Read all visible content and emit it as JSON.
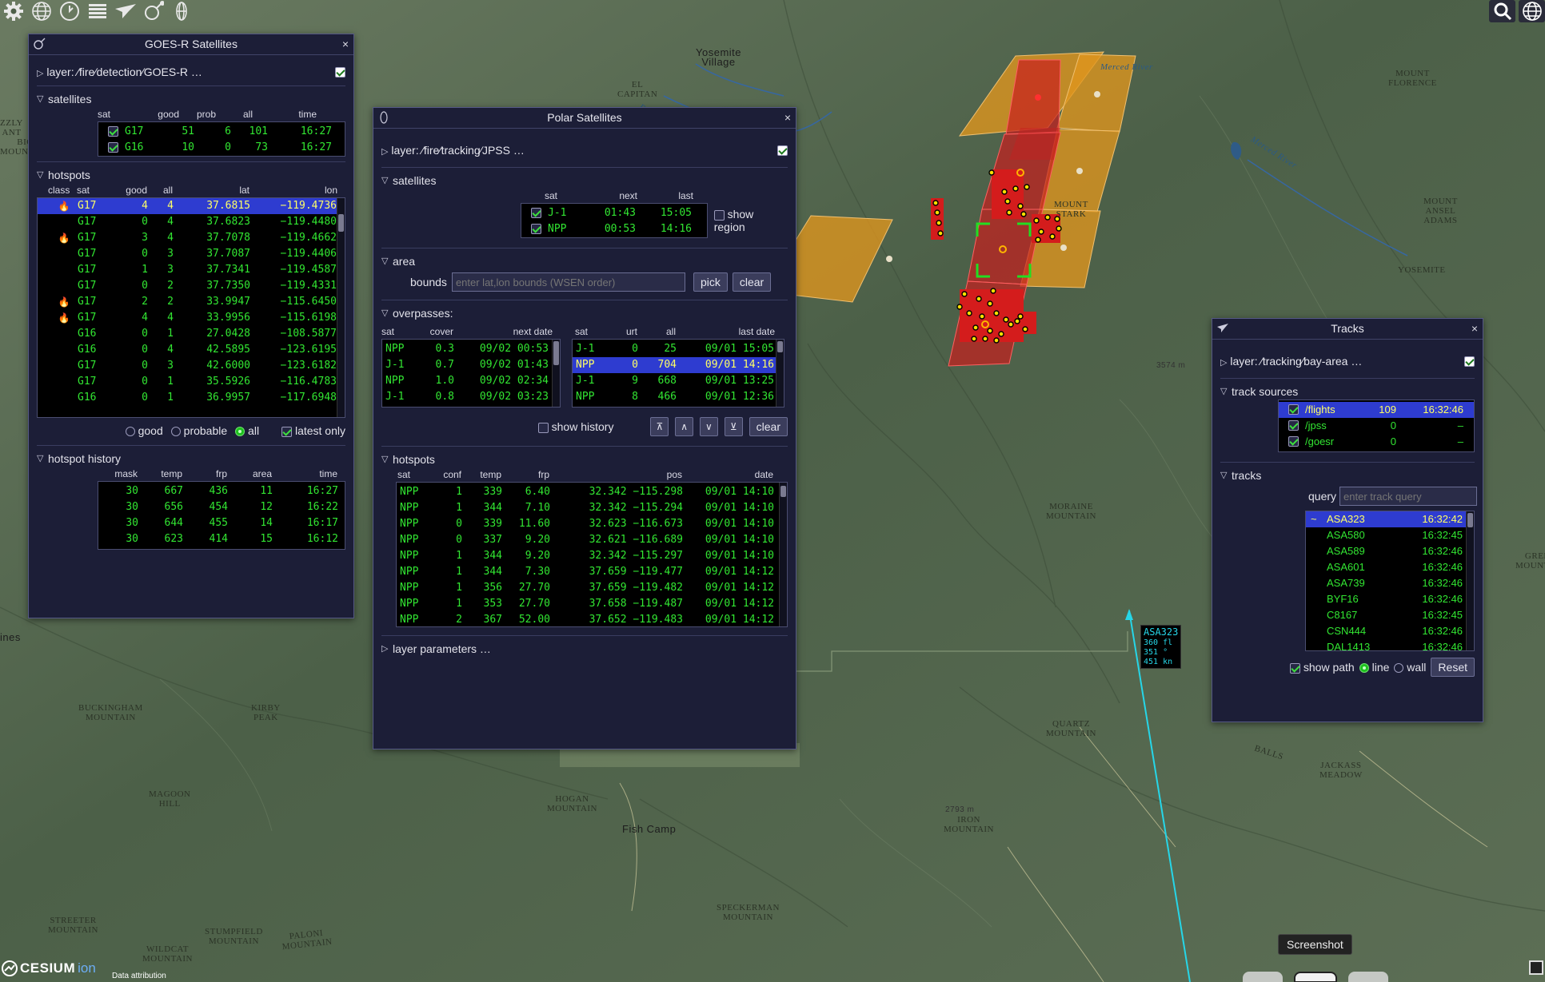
{
  "colors": {
    "window_bg": "#1c1e37",
    "list_fg": "#32e632",
    "selected_bg": "#2e3cd0",
    "selected_fg": "#ffff66",
    "fire_red": "#c81e1e",
    "fire_orange": "#e0961e",
    "track_line": "#26d6e8"
  },
  "toolbar": {
    "icons": [
      "gear-icon",
      "globe-icon",
      "clock-icon",
      "layers-icon",
      "plane-icon",
      "satellite-icon",
      "polar-satellite-icon"
    ],
    "right_icons": [
      "search-icon",
      "globe-icon"
    ]
  },
  "map_labels": [
    {
      "t": "Yosemite\nVillage",
      "cls": "town"
    },
    {
      "t": "EL\nCAPITAN",
      "cls": ""
    },
    {
      "t": "Merced River",
      "cls": "river"
    },
    {
      "t": "River",
      "cls": "river"
    },
    {
      "t": "Merced River",
      "cls": "river"
    },
    {
      "t": "MOUNT\nFLORENCE",
      "cls": ""
    },
    {
      "t": "MOUNT\nANSEL\nADAMS",
      "cls": ""
    },
    {
      "t": "YOSEMITE",
      "cls": ""
    },
    {
      "t": "GREEN\nMOUNTAIN",
      "cls": ""
    },
    {
      "t": "MOUNT\nSTARK",
      "cls": ""
    },
    {
      "t": "MORAINE\nMOUNTAIN",
      "cls": ""
    },
    {
      "t": "QUARTZ\nMOUNTAIN",
      "cls": ""
    },
    {
      "t": "BUCKINGHAM\nMOUNTAIN",
      "cls": ""
    },
    {
      "t": "KIRBY\nPEAK",
      "cls": ""
    },
    {
      "t": "MAGOON\nHILL",
      "cls": ""
    },
    {
      "t": "HOGAN\nMOUNTAIN",
      "cls": ""
    },
    {
      "t": "Fish Camp",
      "cls": "town"
    },
    {
      "t": "2793 m",
      "cls": "elev"
    },
    {
      "t": "IRON\nMOUNTAIN",
      "cls": ""
    },
    {
      "t": "3574 m",
      "cls": "elev"
    },
    {
      "t": "STREETER\nMOUNTAIN",
      "cls": ""
    },
    {
      "t": "STUMPFIELD\nMOUNTAIN",
      "cls": ""
    },
    {
      "t": "PALONI\nMOUNTAIN",
      "cls": ""
    },
    {
      "t": "WILDCAT\nMOUNTAIN",
      "cls": ""
    },
    {
      "t": "SPECKERMAN\nMOUNTAIN",
      "cls": ""
    },
    {
      "t": "JACKASS\nMEADOW",
      "cls": ""
    },
    {
      "t": "BALLS",
      "cls": ""
    },
    {
      "t": "ines",
      "cls": "town"
    },
    {
      "t": "ZZLY\nANT",
      "cls": ""
    },
    {
      "t": "BIG\nMOUNTAIN",
      "cls": ""
    }
  ],
  "goes": {
    "title": "GOES-R Satellites",
    "layer": "layer: ∕fire∕detection∕GOES-R …",
    "satellites_label": "satellites",
    "sat_headers": [
      "sat",
      "good",
      "prob",
      "all",
      "time"
    ],
    "satellites": [
      {
        "sat": "G17",
        "good": "51",
        "prob": "6",
        "all": "101",
        "time": "16:27"
      },
      {
        "sat": "G16",
        "good": "10",
        "prob": "0",
        "all": "73",
        "time": "16:27"
      }
    ],
    "hotspots_label": "hotspots",
    "hs_headers": [
      "class",
      "sat",
      "good",
      "all",
      "lat",
      "lon"
    ],
    "hotspots": [
      {
        "fire": true,
        "sat": "G17",
        "good": "4",
        "all": "4",
        "lat": "37.6815",
        "lon": "−119.4736"
      },
      {
        "fire": false,
        "sat": "G17",
        "good": "0",
        "all": "4",
        "lat": "37.6823",
        "lon": "−119.4480"
      },
      {
        "fire": true,
        "sat": "G17",
        "good": "3",
        "all": "4",
        "lat": "37.7078",
        "lon": "−119.4662"
      },
      {
        "fire": false,
        "sat": "G17",
        "good": "0",
        "all": "3",
        "lat": "37.7087",
        "lon": "−119.4406"
      },
      {
        "fire": false,
        "sat": "G17",
        "good": "1",
        "all": "3",
        "lat": "37.7341",
        "lon": "−119.4587"
      },
      {
        "fire": false,
        "sat": "G17",
        "good": "0",
        "all": "2",
        "lat": "37.7350",
        "lon": "−119.4331"
      },
      {
        "fire": true,
        "sat": "G17",
        "good": "2",
        "all": "2",
        "lat": "33.9947",
        "lon": "−115.6450"
      },
      {
        "fire": true,
        "sat": "G17",
        "good": "4",
        "all": "4",
        "lat": "33.9956",
        "lon": "−115.6198"
      },
      {
        "fire": false,
        "sat": "G16",
        "good": "0",
        "all": "1",
        "lat": "27.0428",
        "lon": "−108.5877"
      },
      {
        "fire": false,
        "sat": "G16",
        "good": "0",
        "all": "4",
        "lat": "42.5895",
        "lon": "−123.6195"
      },
      {
        "fire": false,
        "sat": "G17",
        "good": "0",
        "all": "3",
        "lat": "42.6000",
        "lon": "−123.6182"
      },
      {
        "fire": false,
        "sat": "G17",
        "good": "0",
        "all": "1",
        "lat": "35.5926",
        "lon": "−116.4783"
      },
      {
        "fire": false,
        "sat": "G16",
        "good": "0",
        "all": "1",
        "lat": "36.9957",
        "lon": "−117.6948"
      }
    ],
    "filters": {
      "good": "good",
      "probable": "probable",
      "all": "all",
      "latest_only": "latest only"
    },
    "history_label": "hotspot history",
    "hist_headers": [
      "mask",
      "temp",
      "frp",
      "area",
      "time"
    ],
    "history": [
      {
        "mask": "30",
        "temp": "667",
        "frp": "436",
        "area": "11",
        "time": "16:27"
      },
      {
        "mask": "30",
        "temp": "656",
        "frp": "454",
        "area": "12",
        "time": "16:22"
      },
      {
        "mask": "30",
        "temp": "644",
        "frp": "455",
        "area": "14",
        "time": "16:17"
      },
      {
        "mask": "30",
        "temp": "623",
        "frp": "414",
        "area": "15",
        "time": "16:12"
      }
    ]
  },
  "polar": {
    "title": "Polar Satellites",
    "layer": "layer: ∕fire∕tracking∕JPSS …",
    "satellites_label": "satellites",
    "sat_headers": [
      "sat",
      "next",
      "last"
    ],
    "satellites": [
      {
        "sat": "J-1",
        "next": "01:43",
        "last": "15:05"
      },
      {
        "sat": "NPP",
        "next": "00:53",
        "last": "14:16"
      }
    ],
    "show_region": "show region",
    "area_label": "area",
    "bounds_label": "bounds",
    "bounds_placeholder": "enter lat,lon bounds (WSEN order)",
    "pick": "pick",
    "clear": "clear",
    "overpasses_label": "overpasses:",
    "op_left_headers": [
      "sat",
      "cover",
      "next date"
    ],
    "op_left": [
      {
        "sat": "NPP",
        "cover": "0.3",
        "date": "09/02 00:53"
      },
      {
        "sat": "J-1",
        "cover": "0.7",
        "date": "09/02 01:43"
      },
      {
        "sat": "NPP",
        "cover": "1.0",
        "date": "09/02 02:34"
      },
      {
        "sat": "J-1",
        "cover": "0.8",
        "date": "09/02 03:23"
      }
    ],
    "op_right_headers": [
      "sat",
      "urt",
      "all",
      "last date"
    ],
    "op_right": [
      {
        "sat": "J-1",
        "urt": "0",
        "all": "25",
        "date": "09/01 15:05"
      },
      {
        "sat": "NPP",
        "urt": "0",
        "all": "704",
        "date": "09/01 14:16"
      },
      {
        "sat": "J-1",
        "urt": "9",
        "all": "668",
        "date": "09/01 13:25"
      },
      {
        "sat": "NPP",
        "urt": "8",
        "all": "466",
        "date": "09/01 12:36"
      }
    ],
    "show_history": "show history",
    "nav": [
      "⊼",
      "∧",
      "∨",
      "⊻"
    ],
    "hotspots_label": "hotspots",
    "hs_headers": [
      "sat",
      "conf",
      "temp",
      "frp",
      "pos",
      "date"
    ],
    "hotspots": [
      {
        "sat": "NPP",
        "conf": "1",
        "temp": "339",
        "frp": "6.40",
        "pos": "32.342 −115.298",
        "date": "09/01 14:10"
      },
      {
        "sat": "NPP",
        "conf": "1",
        "temp": "344",
        "frp": "7.10",
        "pos": "32.342 −115.294",
        "date": "09/01 14:10"
      },
      {
        "sat": "NPP",
        "conf": "0",
        "temp": "339",
        "frp": "11.60",
        "pos": "32.623 −116.673",
        "date": "09/01 14:10"
      },
      {
        "sat": "NPP",
        "conf": "0",
        "temp": "337",
        "frp": "9.20",
        "pos": "32.621 −116.689",
        "date": "09/01 14:10"
      },
      {
        "sat": "NPP",
        "conf": "1",
        "temp": "344",
        "frp": "9.20",
        "pos": "32.342 −115.297",
        "date": "09/01 14:10"
      },
      {
        "sat": "NPP",
        "conf": "1",
        "temp": "344",
        "frp": "7.30",
        "pos": "37.659 −119.477",
        "date": "09/01 14:12"
      },
      {
        "sat": "NPP",
        "conf": "1",
        "temp": "356",
        "frp": "27.70",
        "pos": "37.659 −119.482",
        "date": "09/01 14:12"
      },
      {
        "sat": "NPP",
        "conf": "1",
        "temp": "353",
        "frp": "27.70",
        "pos": "37.658 −119.487",
        "date": "09/01 14:12"
      },
      {
        "sat": "NPP",
        "conf": "2",
        "temp": "367",
        "frp": "52.00",
        "pos": "37.652 −119.483",
        "date": "09/01 14:12"
      }
    ],
    "layer_params": "layer parameters …"
  },
  "tracks": {
    "title": "Tracks",
    "layer": "layer: ∕tracking∕bay-area …",
    "sources_label": "track sources",
    "sources": [
      {
        "name": "/flights",
        "count": "109",
        "time": "16:32:46"
      },
      {
        "name": "/jpss",
        "count": "0",
        "time": "–"
      },
      {
        "name": "/goesr",
        "count": "0",
        "time": "–"
      }
    ],
    "tracks_label": "tracks",
    "query_label": "query",
    "query_placeholder": "enter track query",
    "list": [
      {
        "mark": "~",
        "id": "ASA323",
        "time": "16:32:42"
      },
      {
        "mark": "",
        "id": "ASA580",
        "time": "16:32:45"
      },
      {
        "mark": "",
        "id": "ASA589",
        "time": "16:32:46"
      },
      {
        "mark": "",
        "id": "ASA601",
        "time": "16:32:46"
      },
      {
        "mark": "",
        "id": "ASA739",
        "time": "16:32:46"
      },
      {
        "mark": "",
        "id": "BYF16",
        "time": "16:32:46"
      },
      {
        "mark": "",
        "id": "C8167",
        "time": "16:32:45"
      },
      {
        "mark": "",
        "id": "CSN444",
        "time": "16:32:46"
      },
      {
        "mark": "",
        "id": "DAL1413",
        "time": "16:32:46"
      }
    ],
    "show_path": "show path",
    "line": "line",
    "wall": "wall",
    "reset": "Reset"
  },
  "track_label": {
    "id": "ASA323",
    "lines": [
      "360 fl",
      "351 °",
      "451 kn"
    ]
  },
  "tooltip": "Screenshot",
  "cesium": {
    "logo": "CESIUM",
    "ion": "ion",
    "attribution": "Data attribution"
  }
}
